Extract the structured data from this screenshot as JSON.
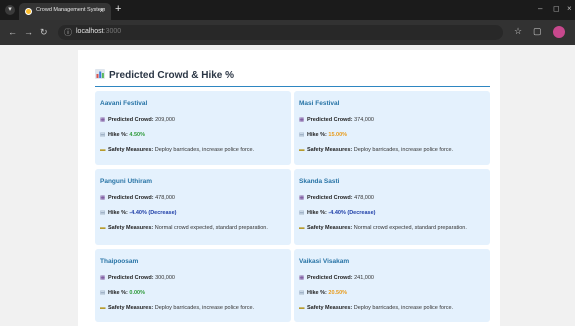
{
  "browser": {
    "tab_title": "Crowd Management System",
    "url_host": "localhost",
    "url_port": ":3000"
  },
  "page": {
    "title": "Predicted Crowd & Hike %"
  },
  "labels": {
    "predicted_crowd": "Predicted Crowd:",
    "hike": "Hike %:",
    "safety": "Safety Measures:"
  },
  "cards": [
    {
      "name": "Aavani Festival",
      "crowd": "209,000",
      "hike": "4.50%",
      "hike_type": "pos",
      "measures": "Deploy barricades, increase police force."
    },
    {
      "name": "Masi Festival",
      "crowd": "374,000",
      "hike": "15.00%",
      "hike_type": "hi",
      "measures": "Deploy barricades, increase police force."
    },
    {
      "name": "Panguni Uthiram",
      "crowd": "478,000",
      "hike": "-4.40% (Decrease)",
      "hike_type": "neg",
      "measures": "Normal crowd expected, standard preparation."
    },
    {
      "name": "Skanda Sasti",
      "crowd": "478,000",
      "hike": "-4.40% (Decrease)",
      "hike_type": "neg",
      "measures": "Normal crowd expected, standard preparation."
    },
    {
      "name": "Thaipoosam",
      "crowd": "300,000",
      "hike": "0.00%",
      "hike_type": "pos",
      "measures": "Deploy barricades, increase police force."
    },
    {
      "name": "Vaikasi Visakam",
      "crowd": "241,000",
      "hike": "20.50%",
      "hike_type": "hi",
      "measures": "Deploy barricades, increase police force."
    }
  ],
  "colors": {
    "accent": "#2874a6",
    "card_bg": "#e4f1fd",
    "hike_positive": "#2e9a3a",
    "hike_decrease": "#1f3fa8",
    "hike_high": "#e89b1a"
  }
}
